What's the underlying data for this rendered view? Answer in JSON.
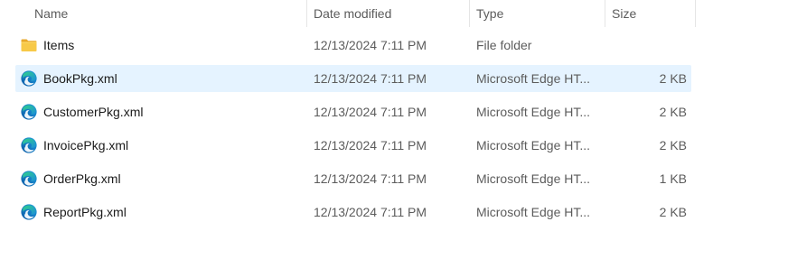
{
  "columns": {
    "name": "Name",
    "date_modified": "Date modified",
    "type": "Type",
    "size": "Size"
  },
  "files": [
    {
      "name": "Items",
      "date": "12/13/2024 7:11 PM",
      "type": "File folder",
      "size": "",
      "icon": "folder-icon",
      "selected": false
    },
    {
      "name": "BookPkg.xml",
      "date": "12/13/2024 7:11 PM",
      "type": "Microsoft Edge HT...",
      "size": "2 KB",
      "icon": "edge-icon",
      "selected": true
    },
    {
      "name": "CustomerPkg.xml",
      "date": "12/13/2024 7:11 PM",
      "type": "Microsoft Edge HT...",
      "size": "2 KB",
      "icon": "edge-icon",
      "selected": false
    },
    {
      "name": "InvoicePkg.xml",
      "date": "12/13/2024 7:11 PM",
      "type": "Microsoft Edge HT...",
      "size": "2 KB",
      "icon": "edge-icon",
      "selected": false
    },
    {
      "name": "OrderPkg.xml",
      "date": "12/13/2024 7:11 PM",
      "type": "Microsoft Edge HT...",
      "size": "1 KB",
      "icon": "edge-icon",
      "selected": false
    },
    {
      "name": "ReportPkg.xml",
      "date": "12/13/2024 7:11 PM",
      "type": "Microsoft Edge HT...",
      "size": "2 KB",
      "icon": "edge-icon",
      "selected": false
    }
  ],
  "colors": {
    "selection": "#e5f3ff",
    "folder": "#f4c24a",
    "edge_blue": "#1a7fd6",
    "edge_green": "#3fbf5a"
  }
}
